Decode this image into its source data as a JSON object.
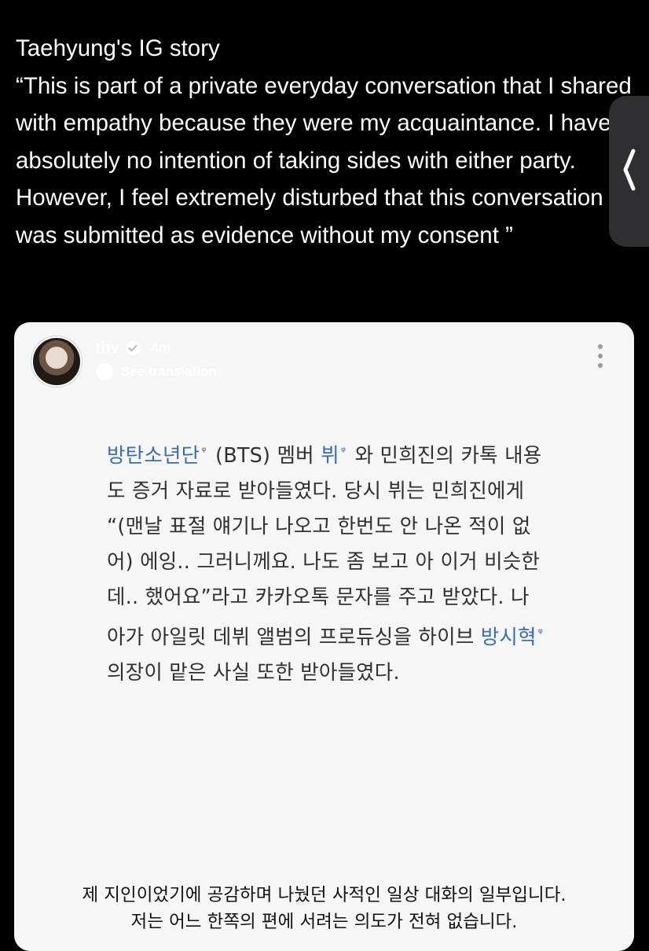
{
  "tweet": {
    "text": "Taehyung's IG story\n“This is part of a private everyday conversation that I shared with empathy because they were my acquaintance. I have absolutely no intention of taking sides with either party. However, I feel extremely disturbed that this conversation was submitted as evidence without my consent ”"
  },
  "story": {
    "username": "thv",
    "time_ago": "4m",
    "see_translation": "See translation",
    "article": {
      "link1": "방탄소년단",
      "part1": " (BTS) 멤버 ",
      "link2": "뷔",
      "part2": " 와 민희진의 카톡 내용도 증거 자료로 받아들였다. 당시 뷔는 민희진에게 “(맨날 표절 얘기나 나오고 한번도 안 나온 적이 없어) 에잉.. 그러니께요. 나도 좀 보고 아 이거 비슷한데.. 했어요”라고 카카오톡 문자를 주고 받았다. 나아가 아일릿 데뷔 앨범의 프로듀싱을 하이브 ",
      "link3": "방시혁",
      "part3": " 의장이 맡은 사실 또한 받아들였다."
    },
    "caption_line1": "제 지인이었기에 공감하며 나눴던 사적인 일상 대화의 일부입니다.",
    "caption_line2": "저는 어느 한쪽의 편에 서려는 의도가 전혀 없습니다."
  },
  "icons": {
    "side": "chevron-left-icon",
    "more": "more-vertical-icon",
    "search": "search-icon"
  }
}
